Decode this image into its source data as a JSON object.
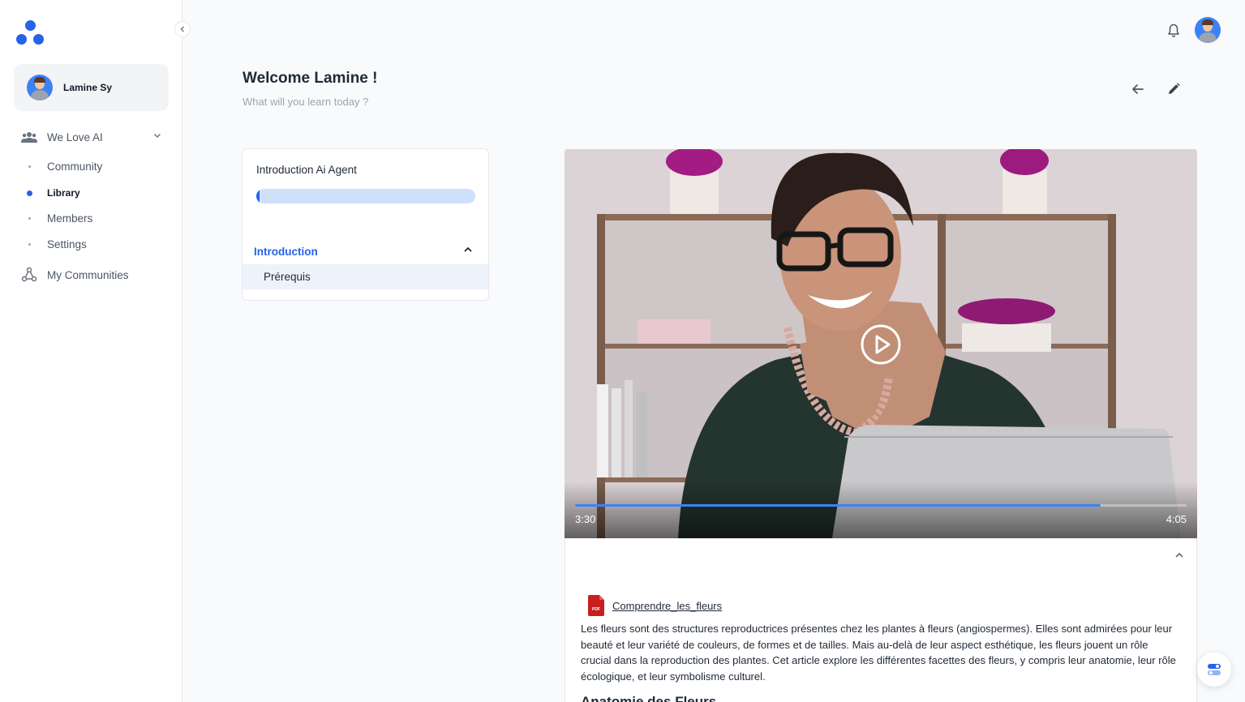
{
  "sidebar": {
    "user_name": "Lamine Sy",
    "group": {
      "label": "We Love AI"
    },
    "items": [
      {
        "label": "Community"
      },
      {
        "label": "Library"
      },
      {
        "label": "Members"
      },
      {
        "label": "Settings"
      }
    ],
    "my_communities": "My Communities"
  },
  "header": {
    "welcome": "Welcome Lamine !",
    "subtitle": "What will you learn today ?"
  },
  "course": {
    "title": "Introduction Ai Agent",
    "progress": 0.01,
    "section": "Introduction",
    "lessons": [
      {
        "label": "Prérequis"
      }
    ]
  },
  "video": {
    "current_time": "3:30",
    "total_time": "4:05",
    "progress": 0.86
  },
  "content": {
    "attachment": "Comprendre_les_fleurs",
    "paragraph": "Les fleurs sont des structures reproductrices présentes chez les plantes à fleurs (angiospermes). Elles sont admirées pour leur beauté et leur variété de couleurs, de formes et de tailles. Mais au-delà de leur aspect esthétique, les fleurs jouent un rôle crucial dans la reproduction des plantes. Cet article explore les différentes facettes des fleurs, y compris leur anatomie, leur rôle écologique, et leur symbolisme culturel.",
    "next_heading": "Anatomie des Fleurs"
  },
  "colors": {
    "accent": "#2563eb",
    "progress_track": "#cfe0fb",
    "pdf_red": "#c81e1e"
  }
}
